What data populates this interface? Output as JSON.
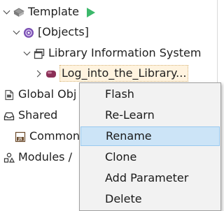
{
  "tree": {
    "template": {
      "label": "Template",
      "icon": "template-icon",
      "run_icon": "play-icon"
    },
    "objects": {
      "label": "[Objects]",
      "icon": "objects-icon"
    },
    "app": {
      "label": "Library Information System",
      "icon": "window-icon"
    },
    "selected": {
      "label": "Log_into_the_Library...",
      "icon": "page-object-icon"
    },
    "global_objects": {
      "label": "Global Obj",
      "icon": "document-icon"
    },
    "shared": {
      "label": "Shared",
      "icon": "shared-icon"
    },
    "common": {
      "label": "Common",
      "icon": "js-file-icon",
      "badge": "JS"
    },
    "modules": {
      "label": "Modules /",
      "icon": "modules-icon"
    }
  },
  "context_menu": {
    "items": [
      "Flash",
      "Re-Learn",
      "Rename",
      "Clone",
      "Add Parameter",
      "Delete"
    ],
    "active_index": 2
  },
  "colors": {
    "play": "#3cb86b",
    "menu_highlight": "#cce4f7",
    "selection_bg": "#fff3df"
  }
}
